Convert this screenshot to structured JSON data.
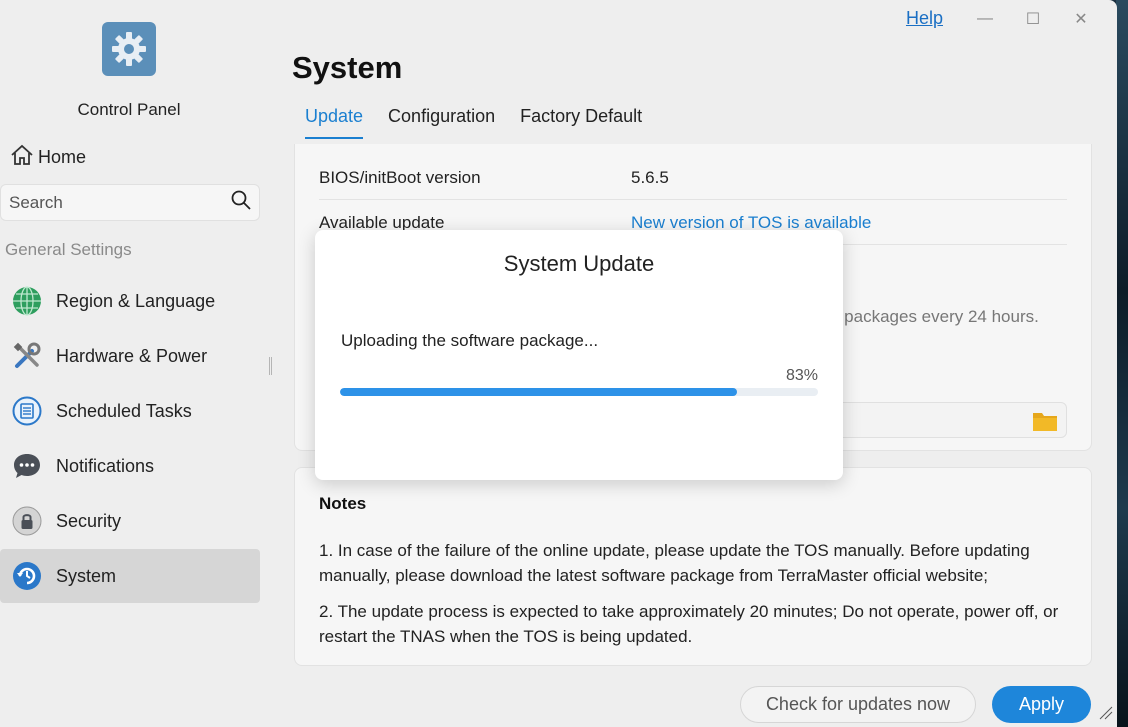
{
  "app": {
    "title": "Control Panel",
    "help": "Help"
  },
  "sidebar": {
    "home": "Home",
    "search_placeholder": "Search",
    "group": "General Settings",
    "items": [
      {
        "label": "Region & Language",
        "icon": "globe-icon"
      },
      {
        "label": "Hardware & Power",
        "icon": "tools-icon"
      },
      {
        "label": "Scheduled Tasks",
        "icon": "tasks-icon"
      },
      {
        "label": "Notifications",
        "icon": "chat-icon"
      },
      {
        "label": "Security",
        "icon": "lock-icon"
      },
      {
        "label": "System",
        "icon": "system-update-icon",
        "active": true
      }
    ]
  },
  "main": {
    "title": "System",
    "tabs": [
      {
        "label": "Update",
        "active": true
      },
      {
        "label": "Configuration"
      },
      {
        "label": "Factory Default"
      }
    ],
    "rows": [
      {
        "key": "BIOS/initBoot version",
        "value": "5.6.5"
      },
      {
        "key": "Available update",
        "value": "New version of TOS is available"
      }
    ],
    "background_text": "e packages every 24 hours.",
    "notes": {
      "title": "Notes",
      "items": [
        "1. In case of the failure of the online update, please update the TOS manually. Before updating manually, please download the latest software package from TerraMaster official website;",
        "2. The update process is expected to take approximately 20 minutes; Do not operate, power off, or restart the TNAS when the TOS is being updated."
      ]
    },
    "buttons": {
      "check": "Check for updates now",
      "apply": "Apply"
    }
  },
  "dialog": {
    "title": "System Update",
    "message": "Uploading the software package...",
    "progress_label": "83%",
    "progress": 0.83
  },
  "colors": {
    "accent": "#1e86da",
    "link": "#1a7fd0",
    "progress": "#2d92e8"
  }
}
